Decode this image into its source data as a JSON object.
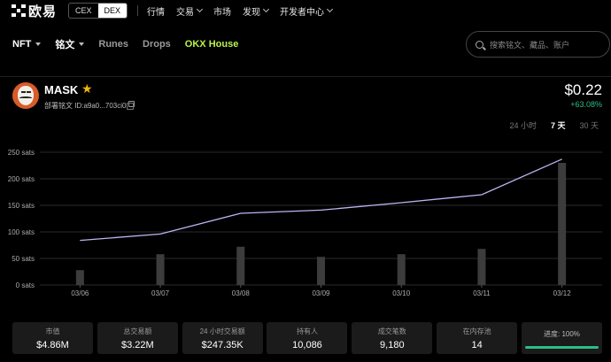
{
  "nav": {
    "logo_text": "欧易",
    "cex_label": "CEX",
    "dex_label": "DEX",
    "items": [
      "行情",
      "交易",
      "市场",
      "发现",
      "开发者中心"
    ]
  },
  "subnav": {
    "items": [
      "NFT",
      "铭文",
      "Runes",
      "Drops",
      "OKX House"
    ]
  },
  "search": {
    "placeholder": "搜索铭文、藏品、账户"
  },
  "token": {
    "name": "MASK",
    "id_text": "部署铭文 ID:a9a0...703ci0",
    "price": "$0.22",
    "change": "+63.08%"
  },
  "time_tabs": [
    "24 小时",
    "7 天",
    "30 天"
  ],
  "time_tab_active": "7 天",
  "chart_data": {
    "type": "bar",
    "categories": [
      "03/06",
      "03/07",
      "03/08",
      "03/09",
      "03/10",
      "03/11",
      "03/12"
    ],
    "y_ticks": [
      "0 sats",
      "50 sats",
      "100 sats",
      "150 sats",
      "200 sats",
      "250 sats"
    ],
    "ylim": [
      0,
      250
    ],
    "grid": true,
    "series": [
      {
        "type": "bar",
        "values": [
          28,
          58,
          72,
          53,
          58,
          68,
          230
        ]
      },
      {
        "type": "line",
        "values": [
          84,
          96,
          135,
          141,
          155,
          170,
          237
        ]
      }
    ],
    "colors": {
      "bar": "#3c3c3c",
      "line": "#b9b6f2",
      "grid": "#2a2a2a"
    }
  },
  "stats": [
    {
      "label": "市值",
      "value": "$4.86M"
    },
    {
      "label": "总交易额",
      "value": "$3.22M"
    },
    {
      "label": "24 小时交易额",
      "value": "$247.35K"
    },
    {
      "label": "持有人",
      "value": "10,086"
    },
    {
      "label": "成交笔数",
      "value": "9,180"
    },
    {
      "label": "在内存池",
      "value": "14"
    }
  ],
  "progress": {
    "label": "进度: 100%",
    "fraction": 1.0
  },
  "colors": {
    "accent_green": "#2ebd85",
    "house_green": "#b9f34a",
    "star": "#f0b90b"
  }
}
